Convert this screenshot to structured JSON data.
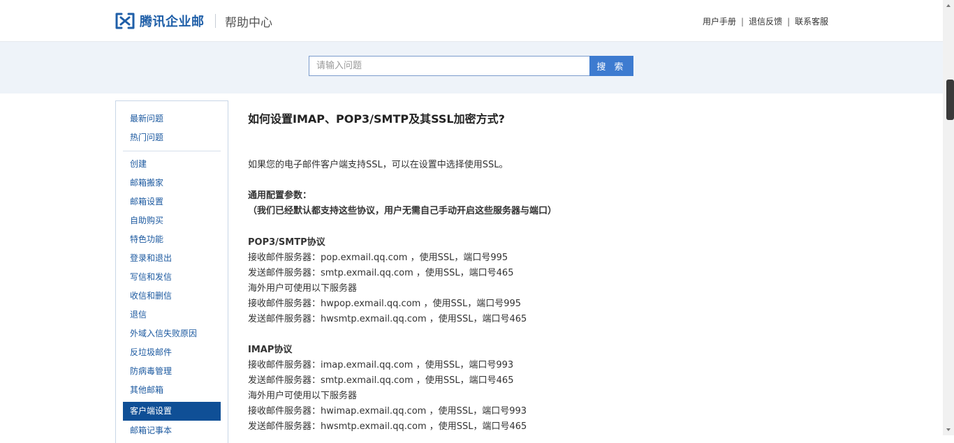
{
  "header": {
    "logo_text": "腾讯企业邮",
    "help_title": "帮助中心",
    "links": [
      "用户手册",
      "退信反馈",
      "联系客服"
    ],
    "separator": "|"
  },
  "search": {
    "placeholder": "请输入问题",
    "button_label": "搜 索"
  },
  "sidebar": {
    "items_top": [
      "最新问题",
      "热门问题"
    ],
    "items": [
      "创建",
      "邮箱搬家",
      "邮箱设置",
      "自助购买",
      "特色功能",
      "登录和退出",
      "写信和发信",
      "收信和删信",
      "退信",
      "外域入信失败原因",
      "反垃圾邮件",
      "防病毒管理",
      "其他邮箱",
      "客户端设置",
      "邮箱记事本"
    ],
    "active": "客户端设置"
  },
  "article": {
    "title": "如何设置IMAP、POP3/SMTP及其SSL加密方式?",
    "lines": [
      "如果您的电子邮件客户端支持SSL，可以在设置中选择使用SSL。",
      "通用配置参数：",
      "（我们已经默认都支持这些协议，用户无需自己手动开启这些服务器与端口）",
      "POP3/SMTP协议",
      "接收邮件服务器：pop.exmail.qq.com ，使用SSL，端口号995",
      "发送邮件服务器：smtp.exmail.qq.com ，使用SSL，端口号465",
      "海外用户可使用以下服务器",
      "接收邮件服务器：hwpop.exmail.qq.com ，使用SSL，端口号995",
      "发送邮件服务器：hwsmtp.exmail.qq.com ，使用SSL，端口号465",
      "IMAP协议",
      "接收邮件服务器：imap.exmail.qq.com  ，使用SSL，端口号993",
      "发送邮件服务器：smtp.exmail.qq.com ，使用SSL，端口号465",
      "海外用户可使用以下服务器",
      "接收邮件服务器：hwimap.exmail.qq.com ，使用SSL，端口号993",
      "发送邮件服务器：hwsmtp.exmail.qq.com ，使用SSL，端口号465"
    ]
  },
  "colors": {
    "brand": "#1f5fa8",
    "search_button": "#3d7bd0",
    "active_nav": "#0f4f96",
    "link": "#1d5aa0"
  },
  "icons": {
    "logo": "tencent-exmail-logo-icon",
    "scroll_up": "scroll-up-arrow-icon",
    "scroll_down": "scroll-down-arrow-icon"
  }
}
